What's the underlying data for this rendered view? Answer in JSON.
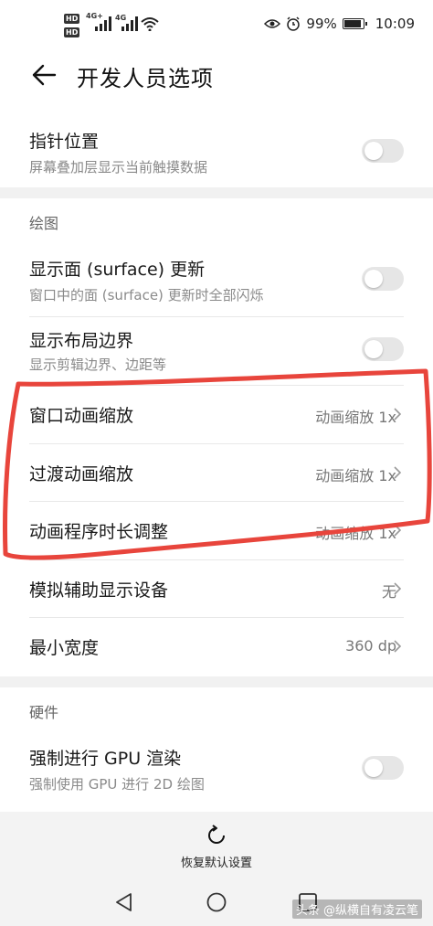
{
  "status_bar": {
    "hd1": "HD",
    "hd2": "HD",
    "net1": "4G+",
    "net2": "4G",
    "battery": "99%",
    "time": "10:09"
  },
  "header": {
    "title": "开发人员选项"
  },
  "rows": {
    "pointer_location": {
      "title": "指针位置",
      "subtitle": "屏幕叠加层显示当前触摸数据"
    },
    "surface_updates": {
      "title": "显示面 (surface) 更新",
      "subtitle": "窗口中的面 (surface) 更新时全部闪烁"
    },
    "layout_bounds": {
      "title": "显示布局边界",
      "subtitle": "显示剪辑边界、边距等"
    },
    "window_anim": {
      "title": "窗口动画缩放",
      "value": "动画缩放 1x"
    },
    "transition_anim": {
      "title": "过渡动画缩放",
      "value": "动画缩放 1x"
    },
    "animator_duration": {
      "title": "动画程序时长调整",
      "value": "动画缩放 1x"
    },
    "secondary_display": {
      "title": "模拟辅助显示设备",
      "value": "无"
    },
    "min_width": {
      "title": "最小宽度",
      "value": "360 dp"
    },
    "force_gpu": {
      "title": "强制进行 GPU 渲染",
      "subtitle": "强制使用 GPU 进行 2D 绘图"
    }
  },
  "sections": {
    "drawing": "绘图",
    "hardware": "硬件"
  },
  "bottom": {
    "reset_label": "恢复默认设置",
    "watermark": "头条 @纵横自有凌云笔"
  },
  "colors": {
    "annotation": "#e8453c",
    "toggle_off": "#e6e6e6"
  }
}
